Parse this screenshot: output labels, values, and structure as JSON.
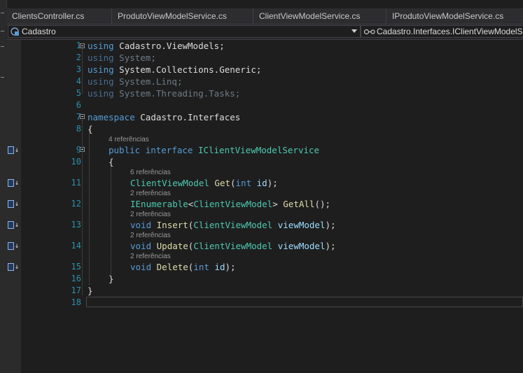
{
  "tabs": [
    {
      "label": "ClientsController.cs"
    },
    {
      "label": "ProdutoViewModelService.cs"
    },
    {
      "label": "ClientViewModelService.cs"
    },
    {
      "label": "IProdutoViewModelService.cs"
    }
  ],
  "nav": {
    "project": "Cadastro",
    "symbol": "Cadastro.Interfaces.IClientViewModelSe"
  },
  "lens": {
    "l9": "4 referências",
    "l11": "6 referências",
    "l12": "2 referências",
    "l13": "2 referências",
    "l14": "2 referências",
    "l15": "2 referências"
  },
  "lines": {
    "n1": "1",
    "n2": "2",
    "n3": "3",
    "n4": "4",
    "n5": "5",
    "n6": "6",
    "n7": "7",
    "n8": "8",
    "n9": "9",
    "n10": "10",
    "n11": "11",
    "n12": "12",
    "n13": "13",
    "n14": "14",
    "n15": "15",
    "n16": "16",
    "n17": "17",
    "n18": "18"
  },
  "code": {
    "using": "using",
    "ns1": "Cadastro",
    "ns1b": "ViewModels",
    "ns2": "System",
    "ns3a": "System",
    "ns3b": "Collections",
    "ns3c": "Generic",
    "ns4a": "System",
    "ns4b": "Linq",
    "ns5a": "System",
    "ns5b": "Threading",
    "ns5c": "Tasks",
    "namespace_kw": "namespace",
    "namespace_a": "Cadastro",
    "namespace_b": "Interfaces",
    "public_kw": "public",
    "interface_kw": "interface",
    "interface_name": "IClientViewModelService",
    "m1_type": "ClientViewModel",
    "m1_name": "Get",
    "int_kw": "int",
    "id_param": "id",
    "m2_type": "IEnumerable",
    "m2_generic": "ClientViewModel",
    "m2_name": "GetAll",
    "void_kw": "void",
    "m3_name": "Insert",
    "vm_type": "ClientViewModel",
    "vm_param": "viewModel",
    "m4_name": "Update",
    "m5_name": "Delete"
  },
  "icons": {
    "implementation": "implementation-arrow-icon",
    "fold": "collapse-toggle-icon",
    "project": "csharp-project-icon",
    "symbol": "interface-symbol-icon"
  },
  "colors": {
    "keyword": "#569cd6",
    "type": "#4ec9b0",
    "method": "#dcdcaa",
    "identifier": "#9cdcfe",
    "line_number": "#2b91af",
    "background": "#1e1e1e"
  }
}
